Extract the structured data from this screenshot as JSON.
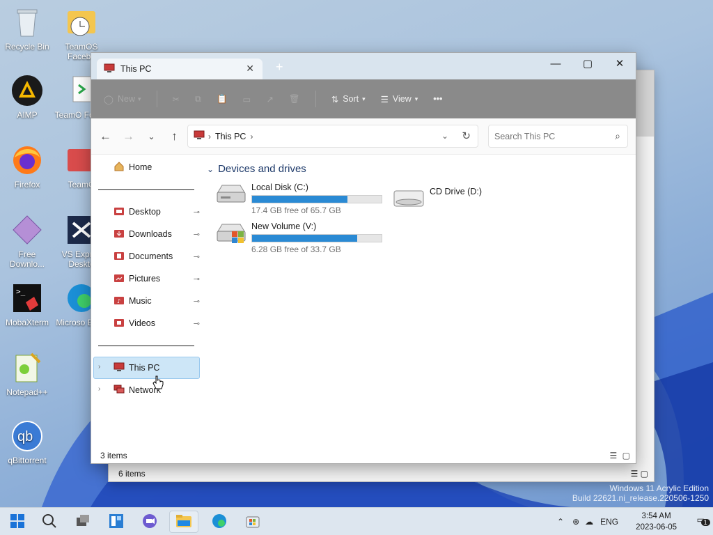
{
  "desktop": {
    "icons": [
      {
        "label": "Recycle Bin"
      },
      {
        "label": "TeamOS Facebo"
      },
      {
        "label": "AIMP"
      },
      {
        "label": "TeamO Forum"
      },
      {
        "label": "Firefox"
      },
      {
        "label": "TeamO"
      },
      {
        "label": "Free Downlo..."
      },
      {
        "label": "VS Expres Deskto"
      },
      {
        "label": "MobaXterm"
      },
      {
        "label": "Microso Edge"
      },
      {
        "label": "Notepad++"
      },
      {
        "label": "qBittorrent"
      }
    ],
    "watermark_line1": "Windows 11 Acrylic Edition",
    "watermark_line2": "Build 22621.ni_release.220506-1250"
  },
  "back_window": {
    "status": "6 items"
  },
  "explorer": {
    "tab_title": "This PC",
    "new_tab": "+",
    "toolbar": {
      "new_label": "New",
      "sort_label": "Sort",
      "view_label": "View",
      "more_label": "•••"
    },
    "address": {
      "crumb": "This PC",
      "search_placeholder": "Search This PC"
    },
    "sidebar": {
      "home": "Home",
      "pinned": [
        {
          "label": "Desktop"
        },
        {
          "label": "Downloads"
        },
        {
          "label": "Documents"
        },
        {
          "label": "Pictures"
        },
        {
          "label": "Music"
        },
        {
          "label": "Videos"
        }
      ],
      "this_pc": "This PC",
      "network": "Network"
    },
    "content": {
      "group_title": "Devices and drives",
      "drives": [
        {
          "name": "Local Disk (C:)",
          "free": "17.4 GB free of 65.7 GB",
          "used_fraction": 0.735
        },
        {
          "name": "New Volume (V:)",
          "free": "6.28 GB free of 33.7 GB",
          "used_fraction": 0.814
        },
        {
          "name": "CD Drive (D:)"
        }
      ]
    },
    "status": "3 items"
  },
  "taskbar": {
    "lang": "ENG",
    "time": "3:54 AM",
    "date": "2023-06-05",
    "notification_count": "1"
  },
  "colors": {
    "accent": "#2a8ad4",
    "selection": "#cde6f7",
    "toolbar": "#8a8a8a"
  }
}
